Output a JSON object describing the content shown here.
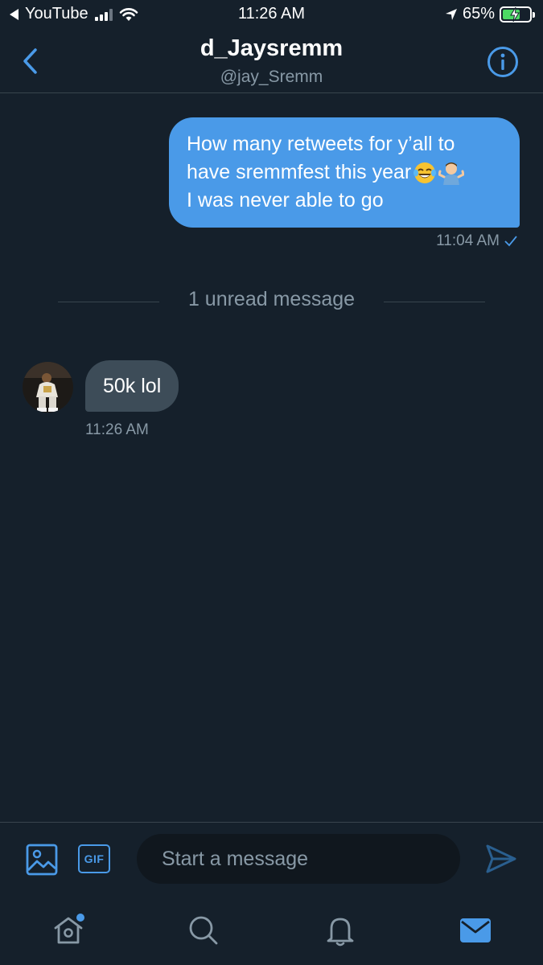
{
  "status_bar": {
    "back_app": "YouTube",
    "time": "11:26 AM",
    "battery_percent": "65%",
    "battery_level": 0.65
  },
  "header": {
    "name": "d_Jaysremm",
    "handle": "@jay_Sremm"
  },
  "messages": [
    {
      "direction": "outgoing",
      "lines": [
        "How many retweets for y’all to",
        "have sremmfest this year",
        "I was never able to go"
      ],
      "emojis": [
        "face-with-tears-of-joy-emoji",
        "man-shrugging-emoji"
      ],
      "time": "11:04 AM"
    },
    {
      "direction": "incoming",
      "text": "50k lol",
      "time": "11:26 AM"
    }
  ],
  "unread_divider": "1 unread message",
  "composer": {
    "gif_label": "GIF",
    "placeholder": "Start a message"
  },
  "tabs": [
    "home-icon",
    "search-icon",
    "notifications-icon",
    "messages-icon"
  ],
  "colors": {
    "background": "#15202b",
    "accent": "#4a9ae8",
    "incoming_bubble": "#3d4c58",
    "secondary_text": "#8899a6"
  }
}
